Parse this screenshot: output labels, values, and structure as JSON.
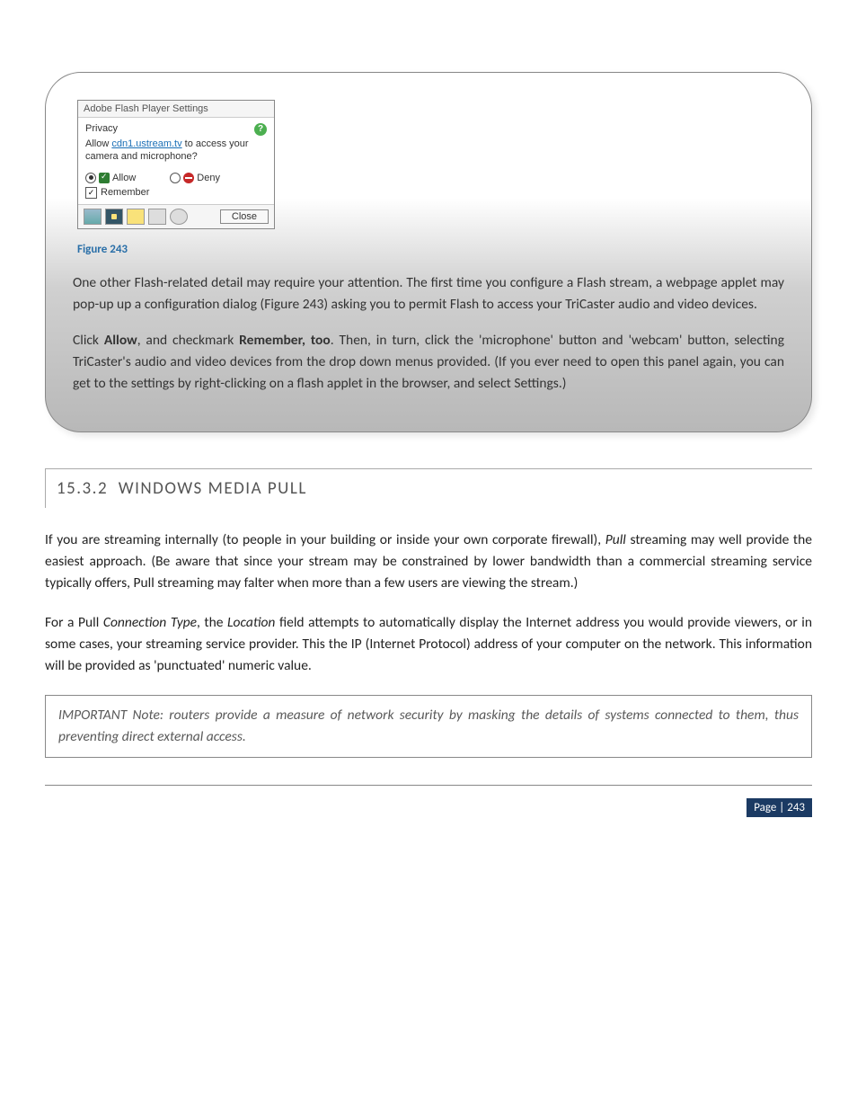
{
  "flash": {
    "title": "Adobe Flash Player Settings",
    "privacy_label": "Privacy",
    "allow_prefix": "Allow ",
    "domain": "cdn1.ustream.tv",
    "allow_suffix": " to access your camera and microphone?",
    "allow_label": "Allow",
    "deny_label": "Deny",
    "remember_label": "Remember",
    "close_label": "Close",
    "help_symbol": "?"
  },
  "figure_caption": "Figure 243",
  "callout_para1_parts": {
    "p1": "One other Flash-related detail may require your attention. The first time you configure a Flash stream, a webpage applet may pop-up up a configuration dialog (",
    "ref": "Figure 243",
    "p2": ") asking you to permit Flash to access your TriCaster audio and video devices."
  },
  "callout_para2_parts": {
    "p1": "Click ",
    "b1": "Allow",
    "p2": ", and checkmark ",
    "b2": "Remember, too",
    "p3": ". Then, in turn, click the 'microphone' button and 'webcam' button, selecting TriCaster's audio and video devices from the drop down menus provided.  (If you ever need to open this panel again, you can get to the settings by right-clicking on a flash applet in the browser, and select Settings.)"
  },
  "section_number": "15.3.2",
  "section_title": "WINDOWS MEDIA PULL",
  "body_para1_parts": {
    "p1": "If you are streaming internally (to people in your building or inside your own corporate firewall), ",
    "i1": "Pull",
    "p2": " streaming may well provide the easiest approach.  (Be aware that since your stream may be constrained by lower bandwidth than a commercial streaming service typically offers, Pull streaming may falter when more than a few users are viewing the stream.)"
  },
  "body_para2_parts": {
    "p1": "For a Pull ",
    "i1": "Connection Type",
    "p2": ", the ",
    "i2": "Location",
    "p3": " field attempts to automatically display the Internet address you would provide viewers, or in some cases, your streaming service provider. This the IP (Internet Protocol) address of your computer on the network. This information will be provided as 'punctuated' numeric value."
  },
  "note_text": "IMPORTANT Note: routers provide a measure of network security by masking the details of systems connected to them, thus preventing direct external access.",
  "page_label": "Page | 243",
  "checkbox_mark": "✓"
}
